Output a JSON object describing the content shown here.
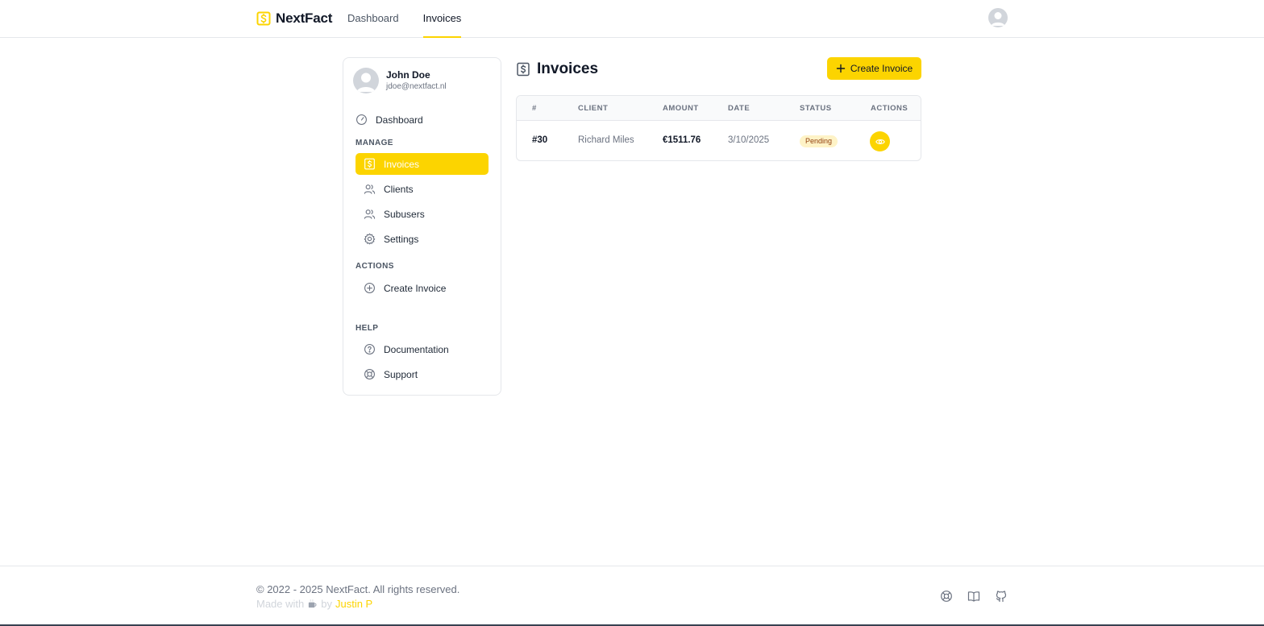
{
  "header": {
    "brand": "NextFact",
    "nav": [
      {
        "label": "Dashboard",
        "active": false
      },
      {
        "label": "Invoices",
        "active": true
      }
    ]
  },
  "sidebar": {
    "user": {
      "name": "John Doe",
      "email": "jdoe@nextfact.nl"
    },
    "dashboard_label": "Dashboard",
    "sections": {
      "manage": "MANAGE",
      "actions": "ACTIONS",
      "help": "HELP"
    },
    "manage_items": [
      {
        "label": "Invoices",
        "icon": "dollar-invoice-icon",
        "active": true
      },
      {
        "label": "Clients",
        "icon": "users-icon"
      },
      {
        "label": "Subusers",
        "icon": "users-icon"
      },
      {
        "label": "Settings",
        "icon": "gear-icon"
      }
    ],
    "action_items": [
      {
        "label": "Create Invoice",
        "icon": "plus-circle-icon"
      }
    ],
    "help_items": [
      {
        "label": "Documentation",
        "icon": "question-circle-icon"
      },
      {
        "label": "Support",
        "icon": "lifebuoy-icon"
      }
    ]
  },
  "main": {
    "title": "Invoices",
    "create_button": "Create Invoice",
    "table": {
      "columns": [
        "#",
        "CLIENT",
        "AMOUNT",
        "DATE",
        "STATUS",
        "ACTIONS"
      ],
      "rows": [
        {
          "id": "#30",
          "client": "Richard Miles",
          "amount": "€1511.76",
          "date": "3/10/2025",
          "status": "Pending"
        }
      ]
    }
  },
  "footer": {
    "copyright": "© 2022 - 2025 NextFact. All rights reserved.",
    "made_with": "Made with",
    "by": "by",
    "author": "Justin P"
  },
  "colors": {
    "accent": "#fcd400",
    "badge_bg": "#fef3c7",
    "badge_text": "#92400e"
  }
}
